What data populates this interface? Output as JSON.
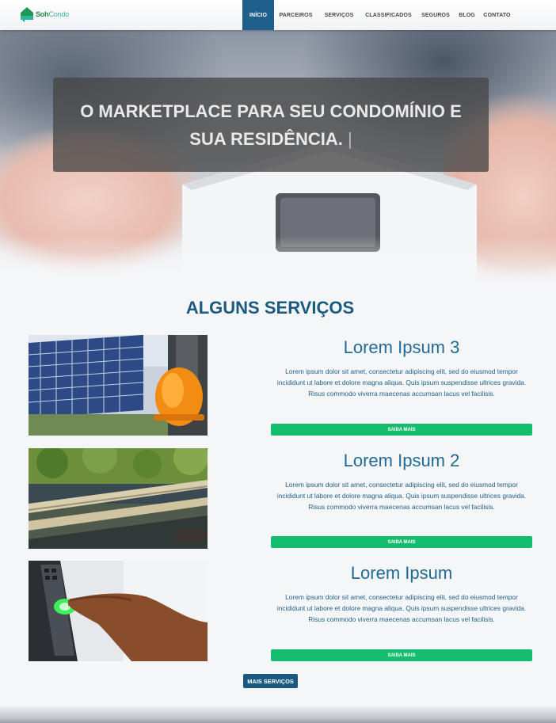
{
  "brand": {
    "name_part1": "Soh",
    "name_part2": "Condo",
    "icon": "house-logo-icon"
  },
  "nav": {
    "items": [
      {
        "label": "INÍCIO",
        "active": true
      },
      {
        "label": "PARCEIROS",
        "active": false
      },
      {
        "label": "SERVIÇOS",
        "active": false
      },
      {
        "label": "CLASSIFICADOS",
        "active": false
      },
      {
        "label": "SEGUROS",
        "active": false
      },
      {
        "label": "BLOG",
        "active": false
      },
      {
        "label": "CONTATO",
        "active": false
      }
    ]
  },
  "hero": {
    "title": "O MARKETPLACE PARA SEU CONDOMÍNIO E SUA RESIDÊNCIA.",
    "cursor": "|"
  },
  "services": {
    "heading": "ALGUNS SERVIÇOS",
    "cards": [
      {
        "title": "Lorem Ipsum 3",
        "text": "Lorem ipsum dolor sit amet, consectetur adipiscing elit, sed do eiusmod tempor incididunt ut labore et dolore magna aliqua. Quis ipsum suspendisse ultrices gravida. Risus commodo viverra maecenas accumsan lacus vel facilisis.",
        "button": "SAIBA MAIS",
        "image": "solar-panel-worker-helmet-image"
      },
      {
        "title": "Lorem Ipsum 2",
        "text": "Lorem ipsum dolor sit amet, consectetur adipiscing elit, sed do eiusmod tempor incididunt ut labore et dolore magna aliqua. Quis ipsum suspendisse ultrices gravida. Risus commodo viverra maecenas accumsan lacus vel facilisis.",
        "button": "SAIBA MAIS",
        "image": "water-treatment-plant-image"
      },
      {
        "title": "Lorem Ipsum",
        "text": "Lorem ipsum dolor sit amet, consectetur adipiscing elit, sed do eiusmod tempor incididunt ut labore et dolore magna aliqua. Quis ipsum suspendisse ultrices gravida. Risus commodo viverra maecenas accumsan lacus vel facilisis.",
        "button": "SAIBA MAIS",
        "image": "fingerprint-scanner-image"
      }
    ],
    "more_button": "MAIS SERVIÇOS"
  },
  "colors": {
    "primary": "#1f5f8b",
    "heading": "#1b5a80",
    "accent_green": "#14bd6e",
    "background": "#f5f6f8"
  }
}
